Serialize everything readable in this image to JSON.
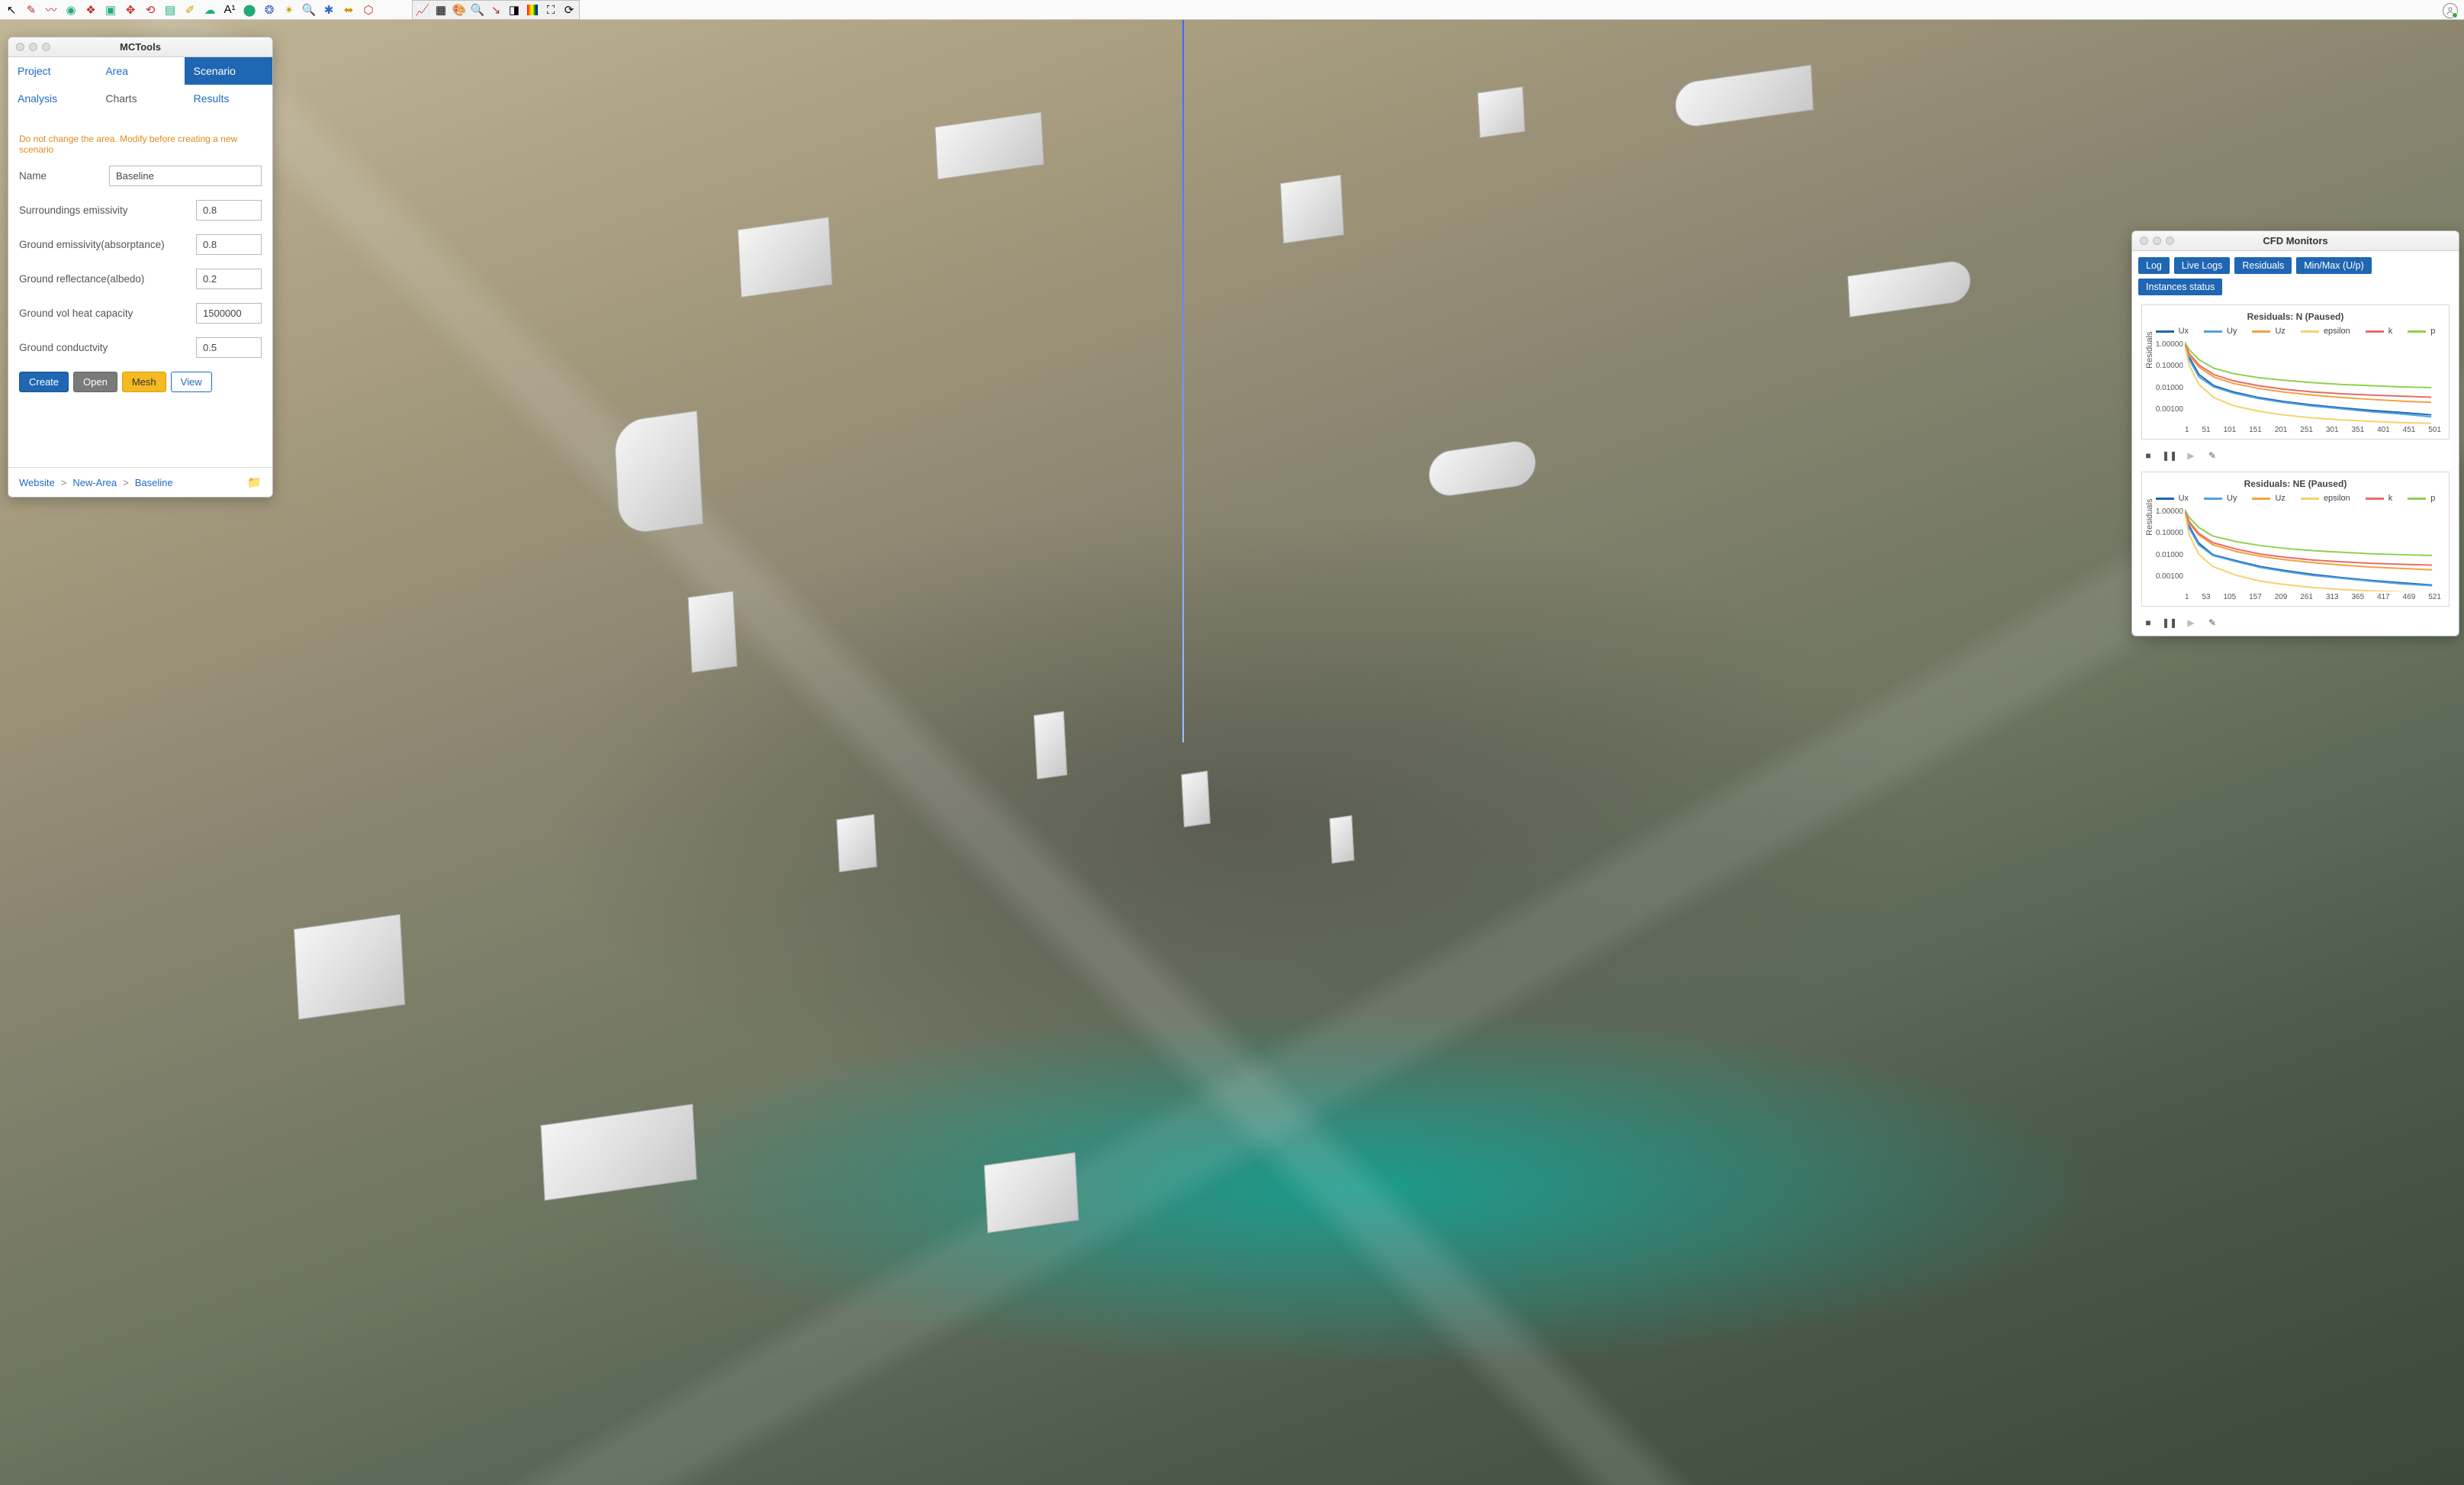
{
  "toolbar_main": {
    "icons": [
      "cursor",
      "pencil",
      "curve",
      "target",
      "layers",
      "cube",
      "move",
      "rotate",
      "edit-doc",
      "paint",
      "bubble",
      "label",
      "sphere",
      "globe",
      "wand",
      "search",
      "join",
      "dimension",
      "shield"
    ]
  },
  "toolbar_secondary": {
    "icons": [
      "axes",
      "grid",
      "palette",
      "zoom-fit",
      "wind",
      "shade",
      "colorbar",
      "fullscreen",
      "refresh"
    ]
  },
  "mctools": {
    "title": "MCTools",
    "tabs": {
      "project": "Project",
      "area": "Area",
      "scenario": "Scenario",
      "analysis": "Analysis",
      "charts": "Charts",
      "results": "Results"
    },
    "active_tab": "scenario",
    "warning": "Do not change the area. Modify before creating a new scenario",
    "fields": {
      "name_label": "Name",
      "name_value": "Baseline",
      "sur_emis_label": "Surroundings emissivity",
      "sur_emis_value": "0.8",
      "grd_emis_label": "Ground emissivity(absorptance)",
      "grd_emis_value": "0.8",
      "grd_refl_label": "Ground reflectance(albedo)",
      "grd_refl_value": "0.2",
      "grd_heat_label": "Ground vol heat capacity",
      "grd_heat_value": "1500000",
      "grd_cond_label": "Ground conductvity",
      "grd_cond_value": "0.5"
    },
    "buttons": {
      "create": "Create",
      "open": "Open",
      "mesh": "Mesh",
      "view": "View"
    },
    "breadcrumb": {
      "website": "Website",
      "area": "New-Area",
      "scenario": "Baseline"
    }
  },
  "cfd": {
    "title": "CFD Monitors",
    "tabs": [
      "Log",
      "Live Logs",
      "Residuals",
      "Min/Max (U/p)",
      "Instances status"
    ],
    "legend": [
      {
        "name": "Ux",
        "color": "#1f66b3"
      },
      {
        "name": "Uy",
        "color": "#4fa3e3"
      },
      {
        "name": "Uz",
        "color": "#f2a23d"
      },
      {
        "name": "epsilon",
        "color": "#f6d16b"
      },
      {
        "name": "k",
        "color": "#e86a6a"
      },
      {
        "name": "p",
        "color": "#8fd14f"
      }
    ],
    "charts": [
      {
        "title": "Residuals: N (Paused)",
        "ylabel": "Residuals",
        "yticks": [
          "1.00000",
          "0.10000",
          "0.01000",
          "0.00100"
        ],
        "xticks": [
          "1",
          "51",
          "101",
          "151",
          "201",
          "251",
          "301",
          "351",
          "401",
          "451",
          "501"
        ]
      },
      {
        "title": "Residuals: NE (Paused)",
        "ylabel": "Residuals",
        "yticks": [
          "1.00000",
          "0.10000",
          "0.01000",
          "0.00100"
        ],
        "xticks": [
          "1",
          "53",
          "105",
          "157",
          "209",
          "261",
          "313",
          "365",
          "417",
          "469",
          "521"
        ]
      }
    ]
  },
  "chart_data": [
    {
      "type": "line",
      "title": "Residuals: N (Paused)",
      "xlabel": "",
      "ylabel": "Residuals",
      "x_range": [
        1,
        521
      ],
      "y_scale": "log",
      "ylim": [
        0.0005,
        1.2
      ],
      "x": [
        1,
        10,
        30,
        60,
        100,
        150,
        200,
        260,
        320,
        380,
        440,
        501
      ],
      "series": [
        {
          "name": "Ux",
          "color": "#1f66b3",
          "values": [
            1.0,
            0.25,
            0.05,
            0.018,
            0.01,
            0.006,
            0.0042,
            0.003,
            0.0023,
            0.0018,
            0.0015,
            0.0012
          ]
        },
        {
          "name": "Uy",
          "color": "#4fa3e3",
          "values": [
            0.9,
            0.2,
            0.04,
            0.016,
            0.009,
            0.0055,
            0.0038,
            0.0027,
            0.0021,
            0.0016,
            0.0013,
            0.001
          ]
        },
        {
          "name": "Uz",
          "color": "#f2a23d",
          "values": [
            0.8,
            0.3,
            0.1,
            0.04,
            0.022,
            0.014,
            0.01,
            0.0075,
            0.006,
            0.005,
            0.0043,
            0.0038
          ]
        },
        {
          "name": "epsilon",
          "color": "#f6d16b",
          "values": [
            0.7,
            0.12,
            0.02,
            0.006,
            0.0028,
            0.0017,
            0.0012,
            0.0009,
            0.00075,
            0.00065,
            0.00058,
            0.00055
          ]
        },
        {
          "name": "k",
          "color": "#e86a6a",
          "values": [
            0.9,
            0.35,
            0.12,
            0.05,
            0.028,
            0.018,
            0.013,
            0.01,
            0.0085,
            0.0075,
            0.0068,
            0.0062
          ]
        },
        {
          "name": "p",
          "color": "#8fd14f",
          "values": [
            1.0,
            0.5,
            0.2,
            0.09,
            0.055,
            0.038,
            0.03,
            0.024,
            0.02,
            0.018,
            0.016,
            0.015
          ]
        }
      ]
    },
    {
      "type": "line",
      "title": "Residuals: NE (Paused)",
      "xlabel": "",
      "ylabel": "Residuals",
      "x_range": [
        1,
        540
      ],
      "y_scale": "log",
      "ylim": [
        0.0005,
        1.2
      ],
      "x": [
        1,
        10,
        30,
        60,
        110,
        160,
        210,
        270,
        330,
        390,
        460,
        521
      ],
      "series": [
        {
          "name": "Ux",
          "color": "#1f66b3",
          "values": [
            1.0,
            0.22,
            0.045,
            0.015,
            0.0085,
            0.005,
            0.0035,
            0.0024,
            0.0018,
            0.0014,
            0.0011,
            0.0009
          ]
        },
        {
          "name": "Uy",
          "color": "#4fa3e3",
          "values": [
            0.9,
            0.18,
            0.038,
            0.014,
            0.0078,
            0.0046,
            0.0032,
            0.0022,
            0.0017,
            0.0013,
            0.001,
            0.00085
          ]
        },
        {
          "name": "Uz",
          "color": "#f2a23d",
          "values": [
            0.8,
            0.28,
            0.095,
            0.038,
            0.02,
            0.013,
            0.0095,
            0.0072,
            0.0058,
            0.0048,
            0.0042,
            0.0037
          ]
        },
        {
          "name": "epsilon",
          "color": "#f6d16b",
          "values": [
            0.7,
            0.1,
            0.016,
            0.005,
            0.0022,
            0.0013,
            0.00095,
            0.00072,
            0.0006,
            0.00053,
            0.00048,
            0.00046
          ]
        },
        {
          "name": "k",
          "color": "#e86a6a",
          "values": [
            0.9,
            0.33,
            0.11,
            0.046,
            0.025,
            0.016,
            0.012,
            0.0092,
            0.0078,
            0.0068,
            0.0062,
            0.0057
          ]
        },
        {
          "name": "p",
          "color": "#8fd14f",
          "values": [
            1.0,
            0.48,
            0.19,
            0.085,
            0.05,
            0.035,
            0.027,
            0.022,
            0.019,
            0.0165,
            0.015,
            0.014
          ]
        }
      ]
    }
  ]
}
